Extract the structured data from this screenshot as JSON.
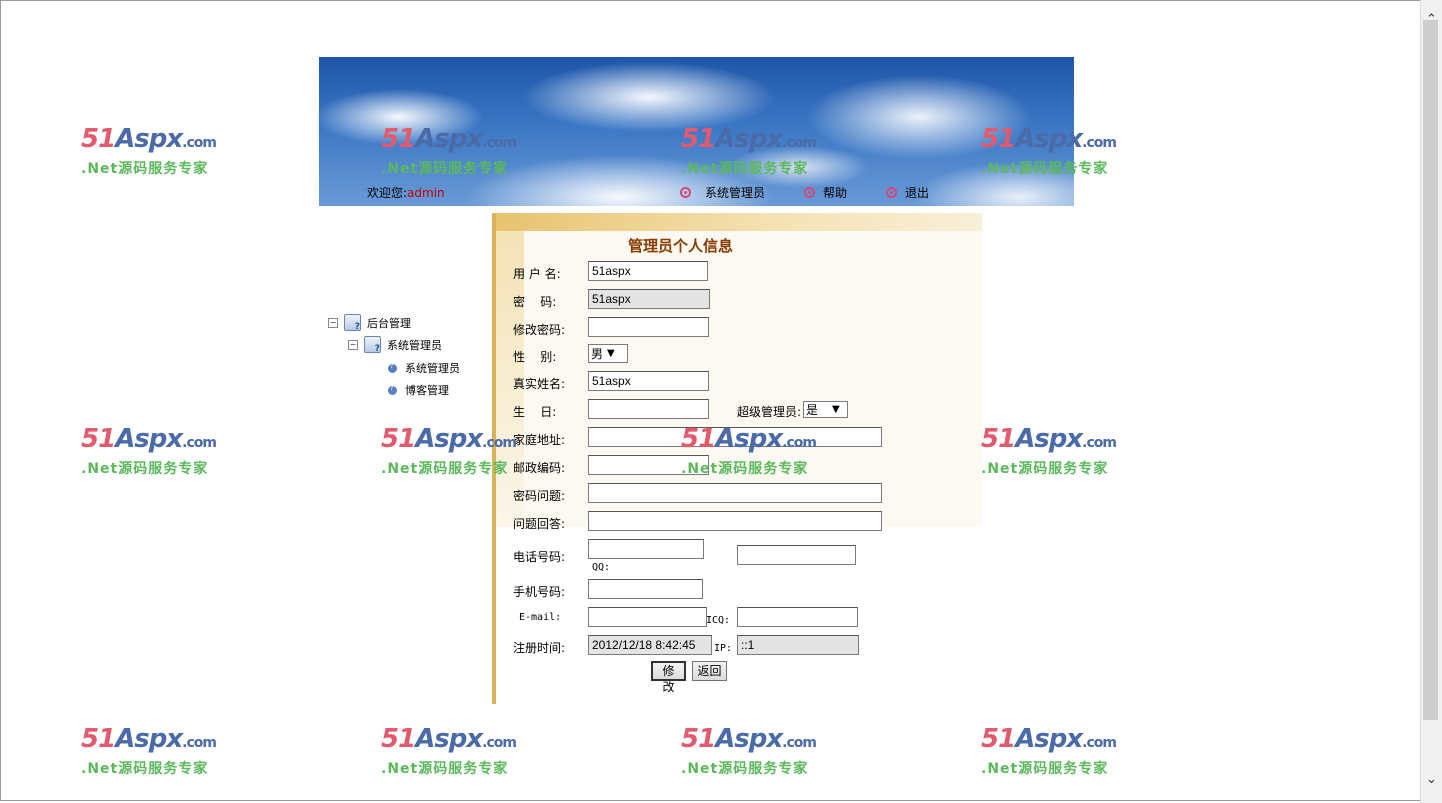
{
  "banner": {
    "welcome_prefix": "欢迎您:",
    "username": "admin",
    "nav": [
      "系统管理员",
      "帮助",
      "退出"
    ]
  },
  "tree": {
    "root": "后台管理",
    "child": "系统管理员",
    "leaves": [
      "系统管理员",
      "博客管理"
    ]
  },
  "form": {
    "title": "管理员个人信息",
    "labels": {
      "username": "用 户 名:",
      "password": "密    码:",
      "new_password": "修改密码:",
      "gender": "性    别:",
      "realname": "真实姓名:",
      "birthday": "生    日:",
      "super_admin": "超级管理员:",
      "address": "家庭地址:",
      "postcode": "邮政编码:",
      "question": "密码问题:",
      "answer": "问题回答:",
      "phone": "电话号码:",
      "qq": "QQ:",
      "mobile": "手机号码:",
      "email": "E-mail:",
      "icq": "ICQ:",
      "regtime": "注册时间:",
      "ip": "IP:"
    },
    "values": {
      "username": "51aspx",
      "password": "51aspx",
      "gender": "男",
      "realname": "51aspx",
      "super_admin": "是",
      "regtime": "2012/12/18 8:42:45",
      "ip": "::1"
    },
    "buttons": {
      "modify": "修改",
      "back": "返回"
    }
  },
  "watermark": {
    "logo_num": "51",
    "logo_name": "Aspx",
    "logo_suffix": ".com",
    "tagline": ".Net源码服务专家"
  }
}
